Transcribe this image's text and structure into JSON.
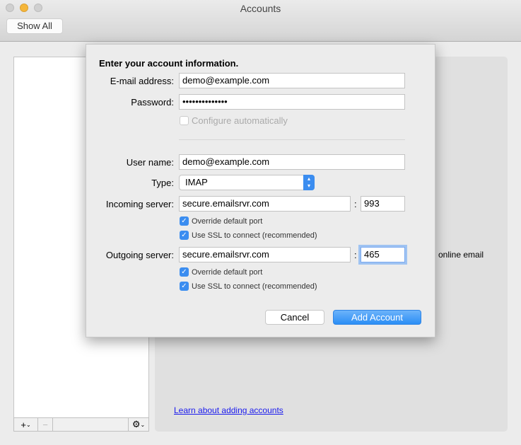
{
  "window": {
    "title": "Accounts",
    "show_all": "Show All"
  },
  "background": {
    "partial_text": "online email",
    "learn_link": "Learn about adding accounts",
    "add_label": "+",
    "remove_label": "−",
    "gear": "gear-icon"
  },
  "sheet": {
    "heading": "Enter your account information.",
    "email_label": "E-mail address:",
    "email_value": "demo@example.com",
    "password_label": "Password:",
    "password_value": "••••••••••••••",
    "configure_auto": "Configure automatically",
    "username_label": "User name:",
    "username_value": "demo@example.com",
    "type_label": "Type:",
    "type_value": "IMAP",
    "incoming_label": "Incoming server:",
    "incoming_value": "secure.emailsrvr.com",
    "incoming_port": "993",
    "outgoing_label": "Outgoing server:",
    "outgoing_value": "secure.emailsrvr.com",
    "outgoing_port": "465",
    "override_port": "Override default port",
    "use_ssl": "Use SSL to connect (recommended)",
    "colon": ":",
    "cancel": "Cancel",
    "add_account": "Add Account",
    "accent": "#3b8df0"
  }
}
